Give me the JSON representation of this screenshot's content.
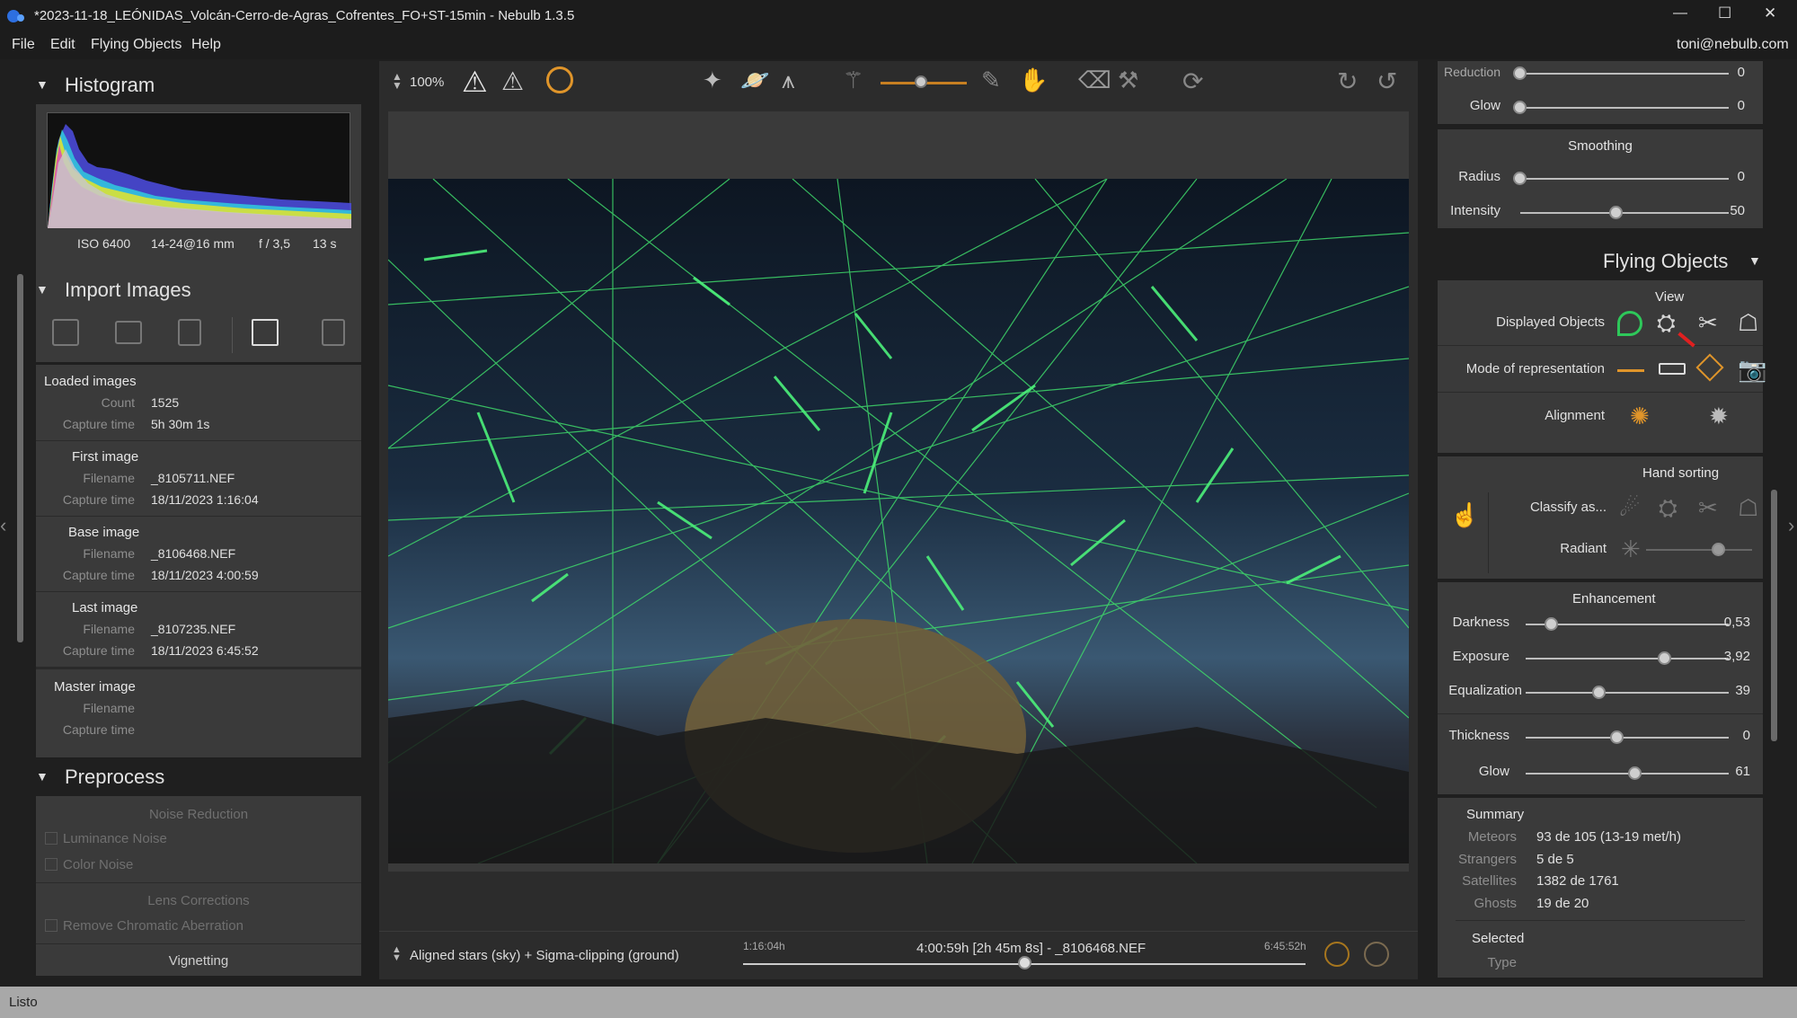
{
  "window": {
    "title": "*2023-11-18_LEÓNIDAS_Volcán-Cerro-de-Agras_Cofrentes_FO+ST-15min - Nebulb 1.3.5",
    "minimize": "—",
    "maximize": "☐",
    "close": "✕"
  },
  "menu": {
    "file": "File",
    "edit": "Edit",
    "flying_objects": "Flying Objects",
    "help": "Help",
    "user": "toni@nebulb.com"
  },
  "histogram": {
    "title": "Histogram",
    "iso": "ISO 6400",
    "lens": "14-24@16 mm",
    "aperture": "f / 3,5",
    "exposure": "13 s"
  },
  "import": {
    "title": "Import Images",
    "loaded": {
      "heading": "Loaded images",
      "count_label": "Count",
      "count": "1525",
      "capture_label": "Capture time",
      "capture": "5h 30m 1s"
    },
    "first": {
      "heading": "First image",
      "filename_label": "Filename",
      "filename": "_8105711.NEF",
      "capture_label": "Capture time",
      "capture": "18/11/2023 1:16:04"
    },
    "base": {
      "heading": "Base image",
      "filename_label": "Filename",
      "filename": "_8106468.NEF",
      "capture_label": "Capture time",
      "capture": "18/11/2023 4:00:59"
    },
    "last": {
      "heading": "Last image",
      "filename_label": "Filename",
      "filename": "_8107235.NEF",
      "capture_label": "Capture time",
      "capture": "18/11/2023 6:45:52"
    },
    "master": {
      "heading": "Master image",
      "filename_label": "Filename",
      "capture_label": "Capture time"
    }
  },
  "preprocess": {
    "title": "Preprocess",
    "noise_reduction": "Noise Reduction",
    "luminance_noise": "Luminance Noise",
    "color_noise": "Color Noise",
    "lens_corrections": "Lens Corrections",
    "remove_ca": "Remove Chromatic Aberration",
    "vignetting": "Vignetting"
  },
  "toolbar": {
    "zoom": "100%"
  },
  "bottom": {
    "mode": "Aligned stars (sky) + Sigma-clipping (ground)",
    "time_start": "1:16:04h",
    "time_current": "4:00:59h [2h 45m 8s] - _8106468.NEF",
    "time_end": "6:45:52h",
    "timeline_position": 0.5
  },
  "right": {
    "reduction_label": "Reduction",
    "reduction_val": "0",
    "glow_label": "Glow",
    "glow_val": "0",
    "smoothing": "Smoothing",
    "radius_label": "Radius",
    "radius_val": "0",
    "intensity_label": "Intensity",
    "intensity_val": "50",
    "flying_title": "Flying Objects",
    "view": "View",
    "displayed_objects": "Displayed Objects",
    "mode_of_representation": "Mode of representation",
    "alignment": "Alignment",
    "hand_sorting": "Hand sorting",
    "classify_as": "Classify as...",
    "radiant": "Radiant",
    "enhancement": "Enhancement",
    "darkness_label": "Darkness",
    "darkness_val": "0,53",
    "exposure_label": "Exposure",
    "exposure_val": "3,92",
    "equalization_label": "Equalization",
    "equalization_val": "39",
    "thickness_label": "Thickness",
    "thickness_val": "0",
    "glow2_label": "Glow",
    "glow2_val": "61",
    "summary": "Summary",
    "meteors_label": "Meteors",
    "meteors_val": "93 de 105 (13-19 met/h)",
    "strangers_label": "Strangers",
    "strangers_val": "5 de 5",
    "satellites_label": "Satellites",
    "satellites_val": "1382 de 1761",
    "ghosts_label": "Ghosts",
    "ghosts_val": "19 de 20",
    "selected": "Selected",
    "type_label": "Type"
  },
  "status": "Listo",
  "colors": {
    "accent": "#e0952a",
    "meteor_lines": "#3fd86a",
    "panel": "#3a3a3a",
    "background": "#1f1f1f"
  }
}
